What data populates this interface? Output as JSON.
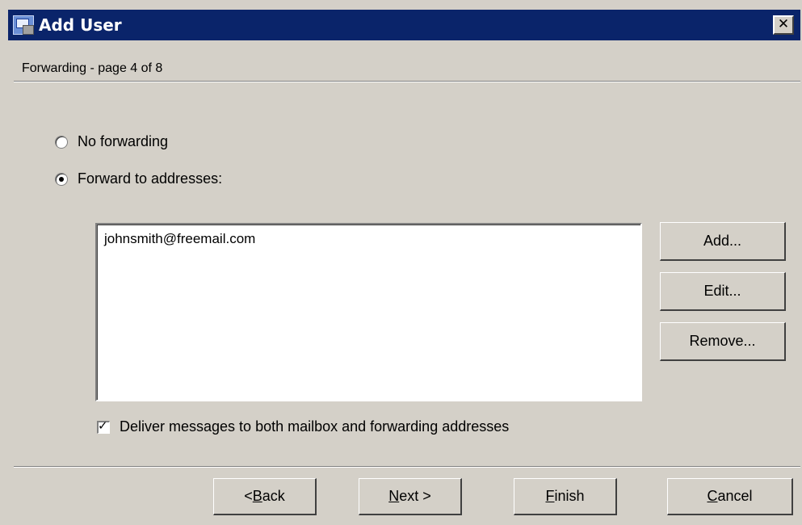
{
  "window": {
    "title": "Add User",
    "close_glyph": "✕"
  },
  "page": {
    "subtitle": "Forwarding - page 4 of 8"
  },
  "forwarding": {
    "option_none": "No forwarding",
    "option_forward": "Forward to addresses:",
    "selected": "forward",
    "addresses": [
      "johnsmith@freemail.com"
    ]
  },
  "side_buttons": {
    "add": "Add...",
    "edit": "Edit...",
    "remove": "Remove..."
  },
  "deliver_both": {
    "label": "Deliver messages to both mailbox and forwarding addresses",
    "checked": true
  },
  "footer": {
    "back": {
      "pre": "< ",
      "mnemonic": "B",
      "post": "ack"
    },
    "next": {
      "pre": "",
      "mnemonic": "N",
      "post": "ext >"
    },
    "finish": {
      "pre": "",
      "mnemonic": "F",
      "post": "inish"
    },
    "cancel": {
      "pre": "",
      "mnemonic": "C",
      "post": "ancel"
    }
  },
  "icons": {
    "app": "user-mailbox-icon",
    "close": "close-icon",
    "check": "checkmark-icon"
  },
  "colors": {
    "titlebar": "#0a246a",
    "dialog_bg": "#d4d0c8"
  }
}
